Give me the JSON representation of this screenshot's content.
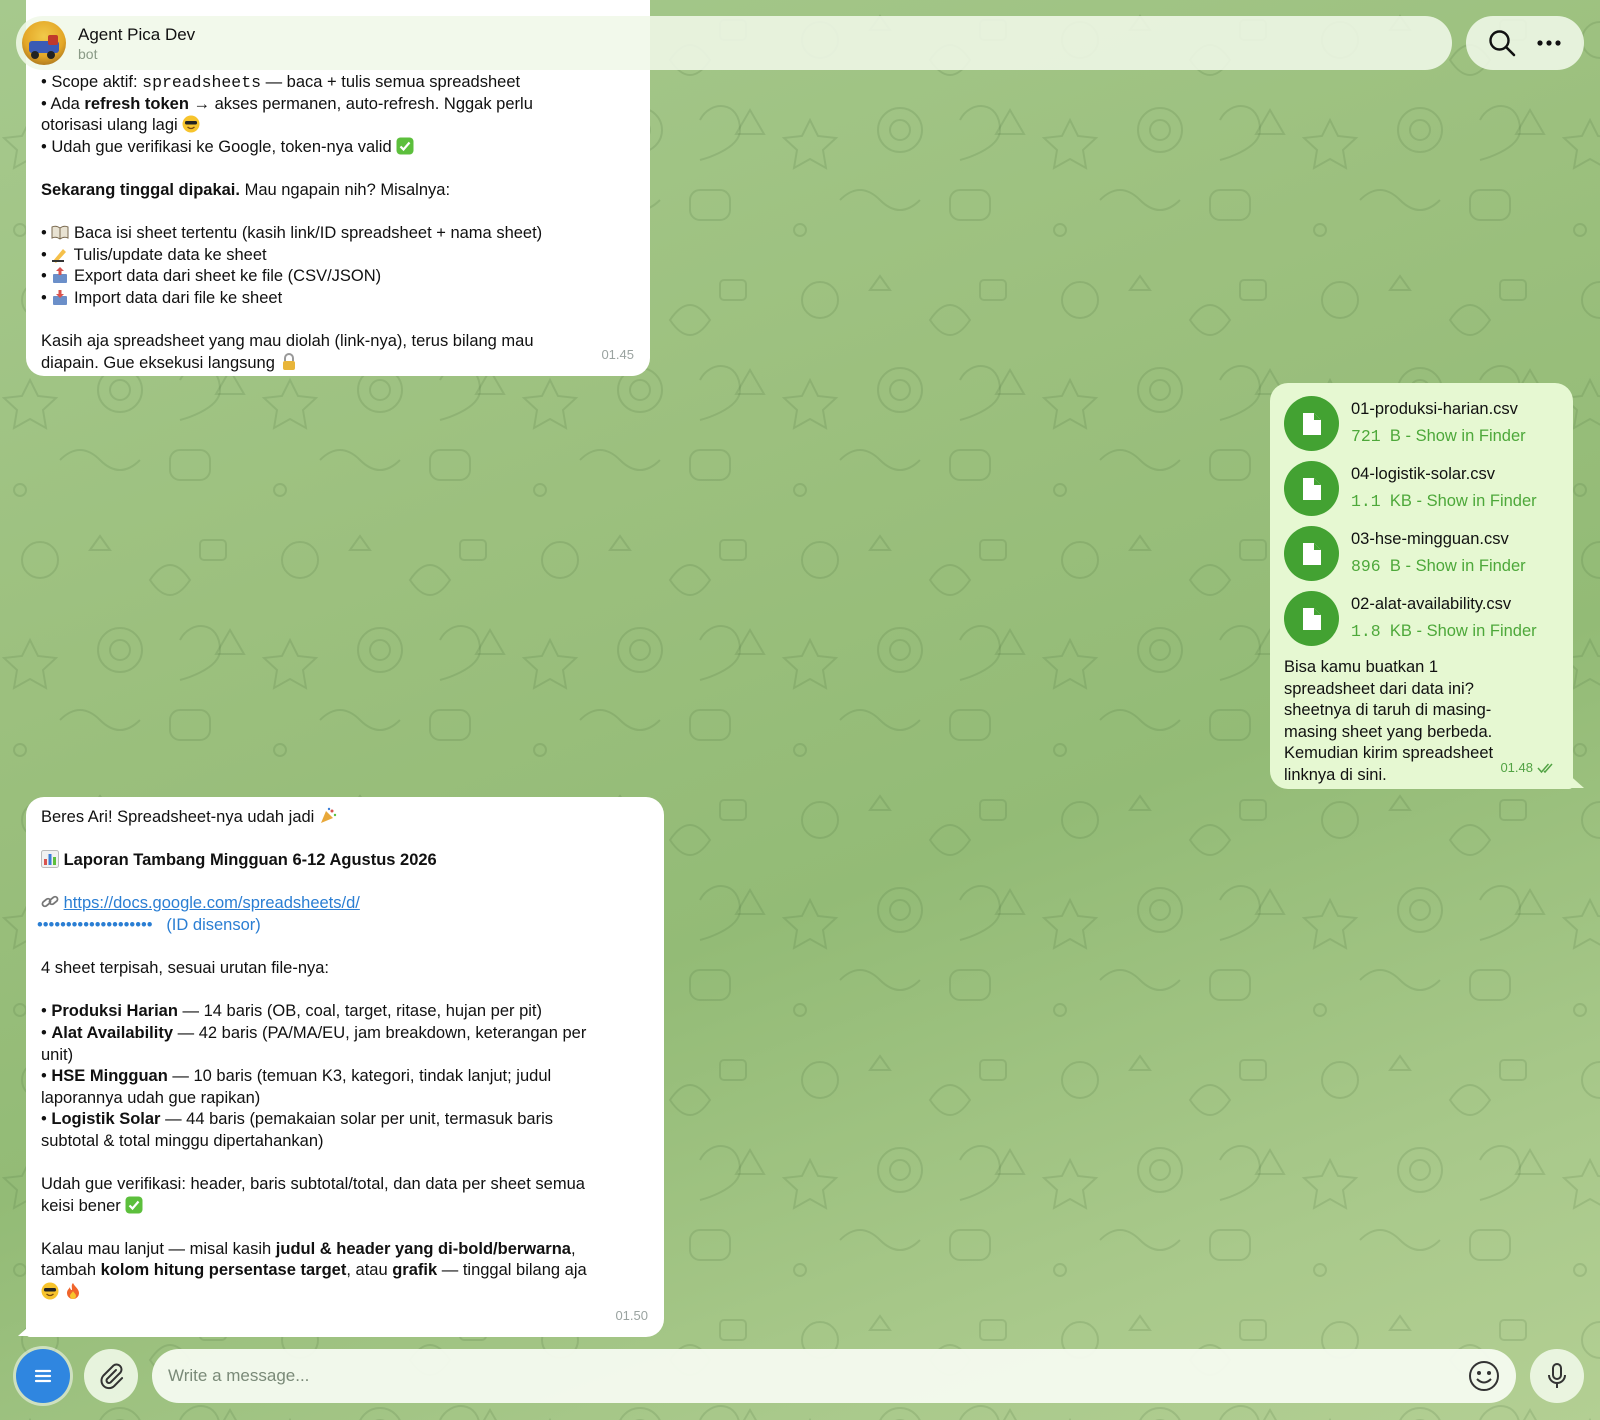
{
  "chat": {
    "name": "Agent Pica Dev",
    "status": "bot"
  },
  "msg1": {
    "lines": [
      "• Scope aktif: ",
      "spreadsheets",
      " — baca + tulis semua spreadsheet",
      "• Ada ",
      "refresh token",
      " → akses permanen, auto-refresh. Nggak perlu",
      "otorisasi ulang lagi",
      "• Udah gue verifikasi ke Google, token-nya valid",
      "Sekarang tinggal dipakai.",
      " Mau ngapain nih? Misalnya:",
      "Baca isi sheet tertentu (kasih link/ID spreadsheet + nama sheet)",
      "Tulis/update data ke sheet",
      "Export data dari sheet ke file (CSV/JSON)",
      "Import data dari file ke sheet",
      "Kasih aja spreadsheet yang mau diolah (link-nya), terus bilang mau",
      "diapain. Gue eksekusi langsung"
    ],
    "time": "01.45"
  },
  "msg2": {
    "files": [
      {
        "name": "01-produksi-harian.csv",
        "size_num": "721",
        "size_unit": "B",
        "action": "Show in Finder"
      },
      {
        "name": "04-logistik-solar.csv",
        "size_num": "1.1",
        "size_unit": "KB",
        "action": "Show in Finder"
      },
      {
        "name": "03-hse-mingguan.csv",
        "size_num": "896",
        "size_unit": "B",
        "action": "Show in Finder"
      },
      {
        "name": "02-alat-availability.csv",
        "size_num": "1.8",
        "size_unit": "KB",
        "action": "Show in Finder"
      }
    ],
    "text_lines": [
      "Bisa kamu buatkan 1",
      "spreadsheet dari data ini?",
      "sheetnya di taruh di masing-",
      "masing sheet yang berbeda.",
      "Kemudian kirim spreadsheet",
      "linknya di sini."
    ],
    "time": "01.48"
  },
  "msg3": {
    "intro": "Beres Ari! Spreadsheet-nya udah jadi",
    "report_title": "Laporan Tambang Mingguan 6-12 Agustus 2026",
    "link": "https://docs.google.com/spreadsheets/d/",
    "link_masked": "••••••••••••••••••••",
    "link_note": "(ID disensor)",
    "sheets_intro": "4 sheet terpisah, sesuai urutan file-nya:",
    "sheets": [
      {
        "name": "Produksi Harian",
        "desc1": " — 14 baris (OB, coal, target, ritase, hujan per pit)",
        "desc2": ""
      },
      {
        "name": "Alat Availability",
        "desc1": " — 42 baris (PA/MA/EU, jam breakdown, keterangan per",
        "desc2": "unit)"
      },
      {
        "name": "HSE Mingguan",
        "desc1": " — 10 baris (temuan K3, kategori, tindak lanjut; judul",
        "desc2": "laporannya udah gue rapikan)"
      },
      {
        "name": "Logistik Solar",
        "desc1": " — 44 baris (pemakaian solar per unit, termasuk baris",
        "desc2": "subtotal & total minggu dipertahankan)"
      }
    ],
    "verify1": "Udah gue verifikasi: header, baris subtotal/total, dan data per sheet semua",
    "verify2": "keisi bener",
    "next_a": "Kalau mau lanjut — misal kasih ",
    "next_b": "judul & header yang di-bold/berwarna",
    "next_c": ",",
    "next_d": "tambah ",
    "next_e": "kolom hitung persentase target",
    "next_f": ", atau ",
    "next_g": "grafik",
    "next_h": " — tinggal bilang aja",
    "time": "01.50"
  },
  "composer": {
    "placeholder": "Write a message..."
  },
  "colors": {
    "accent": "#2f86e0",
    "file_green": "#43a232",
    "outgoing_bubble": "#e6f8d2",
    "link": "#2a7ed3"
  },
  "icons": [
    "search-icon",
    "more-icon",
    "file-icon",
    "menu-icon",
    "paperclip-icon",
    "emoji-icon",
    "microphone-icon",
    "double-check-icon"
  ]
}
